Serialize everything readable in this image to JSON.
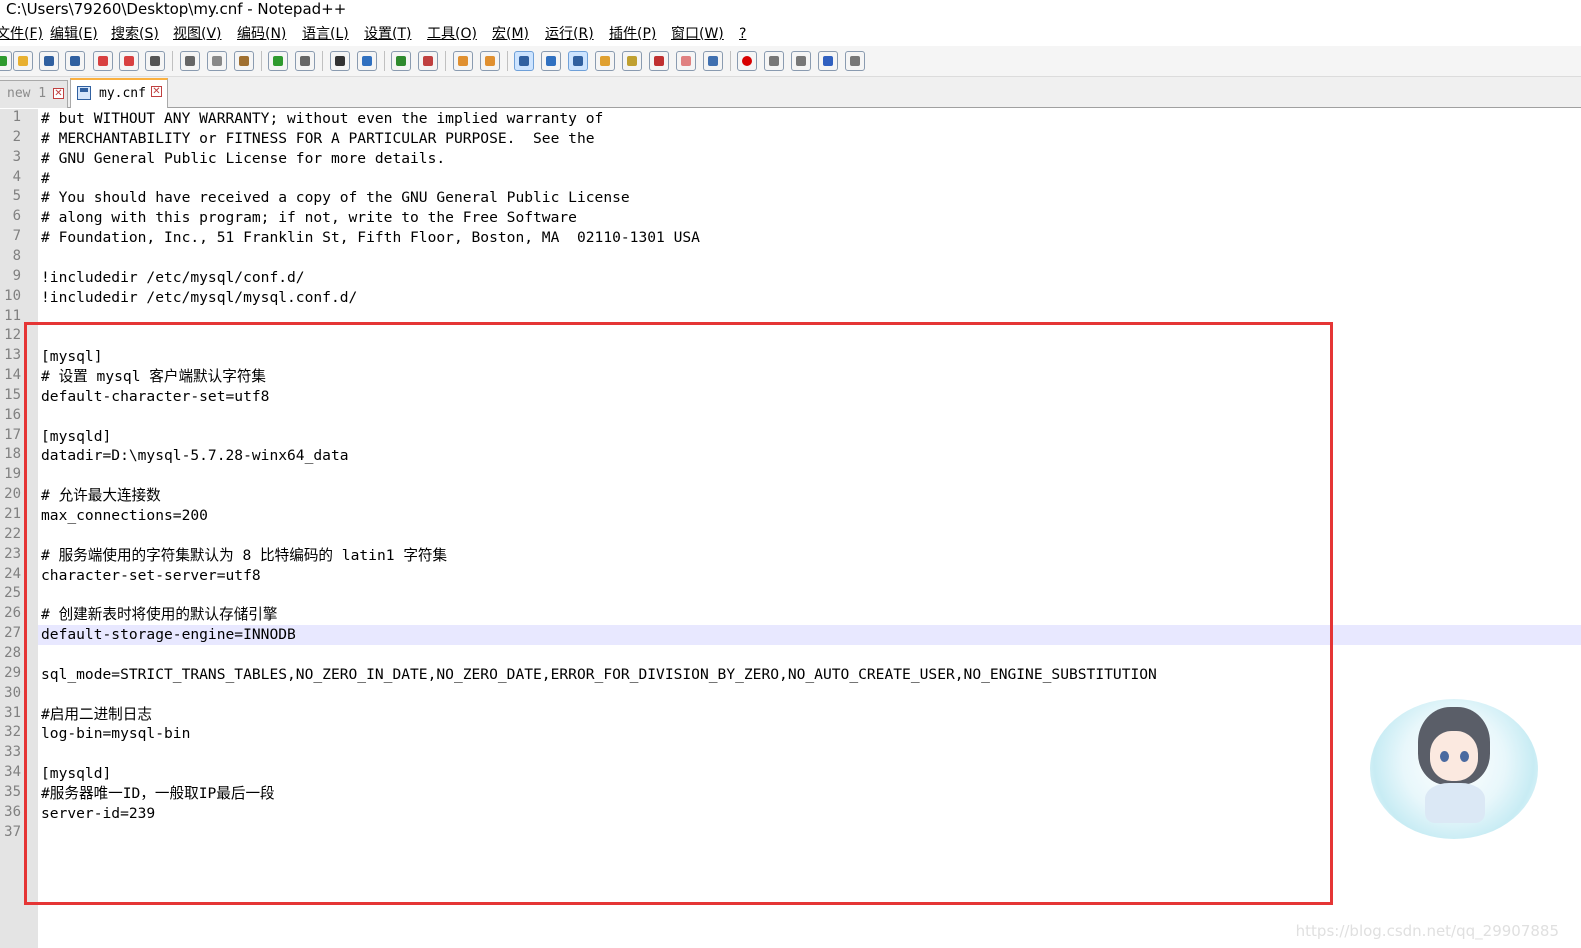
{
  "window": {
    "title": "C:\\Users\\79260\\Desktop\\my.cnf - Notepad++"
  },
  "menu": [
    {
      "label": "文件(F)"
    },
    {
      "label": "编辑(E)"
    },
    {
      "label": "搜索(S)"
    },
    {
      "label": "视图(V)"
    },
    {
      "label": "编码(N)"
    },
    {
      "label": "语言(L)"
    },
    {
      "label": "设置(T)"
    },
    {
      "label": "工具(O)"
    },
    {
      "label": "宏(M)"
    },
    {
      "label": "运行(R)"
    },
    {
      "label": "插件(P)"
    },
    {
      "label": "窗口(W)"
    },
    {
      "label": "?"
    }
  ],
  "tabs": [
    {
      "label": "new 1",
      "active": false
    },
    {
      "label": "my.cnf",
      "active": true
    }
  ],
  "editor": {
    "current_line": 27,
    "lines": [
      "# but WITHOUT ANY WARRANTY; without even the implied warranty of",
      "# MERCHANTABILITY or FITNESS FOR A PARTICULAR PURPOSE.  See the",
      "# GNU General Public License for more details.",
      "#",
      "# You should have received a copy of the GNU General Public License",
      "# along with this program; if not, write to the Free Software",
      "# Foundation, Inc., 51 Franklin St, Fifth Floor, Boston, MA  02110-1301 USA",
      "",
      "!includedir /etc/mysql/conf.d/",
      "!includedir /etc/mysql/mysql.conf.d/",
      "",
      "",
      "[mysql]",
      "# 设置 mysql 客户端默认字符集",
      "default-character-set=utf8",
      "",
      "[mysqld]",
      "datadir=D:\\mysql-5.7.28-winx64_data",
      "",
      "# 允许最大连接数",
      "max_connections=200",
      "",
      "# 服务端使用的字符集默认为 8 比特编码的 latin1 字符集",
      "character-set-server=utf8",
      "",
      "# 创建新表时将使用的默认存储引擎",
      "default-storage-engine=INNODB",
      "",
      "sql_mode=STRICT_TRANS_TABLES,NO_ZERO_IN_DATE,NO_ZERO_DATE,ERROR_FOR_DIVISION_BY_ZERO,NO_AUTO_CREATE_USER,NO_ENGINE_SUBSTITUTION",
      "",
      "#启用二进制日志",
      "log-bin=mysql-bin",
      "",
      "[mysqld]",
      "#服务器唯一ID，一般取IP最后一段",
      "server-id=239",
      ""
    ]
  },
  "watermark": "https://blog.csdn.net/qq_29907885",
  "colors": {
    "highlight_box": "#e53535",
    "gutter": "#e4e4e4",
    "current_line": "#e8e8ff"
  }
}
